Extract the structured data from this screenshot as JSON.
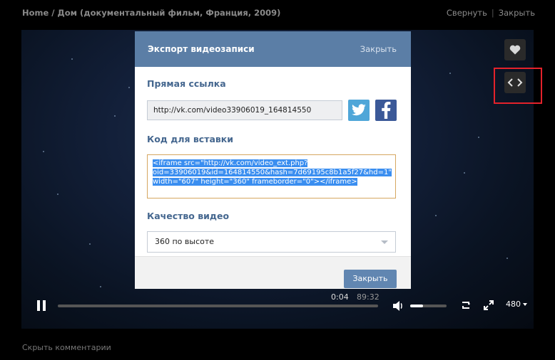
{
  "topbar": {
    "breadcrumb": "Home / Дом (документальный фильм, Франция, 2009)",
    "minimize_label": "Свернуть",
    "separator": "|",
    "close_label": "Закрыть"
  },
  "side": {
    "like_icon": "heart-icon",
    "embed_icon": "code-brackets-icon"
  },
  "modal": {
    "title": "Экспорт видеозаписи",
    "close_link": "Закрыть",
    "direct_link_label": "Прямая ссылка",
    "direct_link_value": "http://vk.com/video33906019_164814550",
    "embed_label": "Код для вставки",
    "embed_lines": [
      "<iframe src=\"http://vk.com/video_ext.php?",
      "oid=33906019&id=164814550&hash=7d69195c8b1a5f27&hd=1\"",
      "width=\"607\" height=\"360\" frameborder=\"0\"></iframe>"
    ],
    "quality_label": "Качество видео",
    "quality_value": "360 по высоте",
    "footer_close": "Закрыть",
    "colors": {
      "header": "#5b7ea6",
      "label": "#45678f",
      "button": "#6186b1"
    }
  },
  "player": {
    "time_current": "0:04",
    "time_total": "89:32",
    "progress_fraction": 0,
    "volume_fraction": 0.35,
    "quality": "480"
  },
  "footer": {
    "hide_comments": "Скрыть комментарии"
  }
}
